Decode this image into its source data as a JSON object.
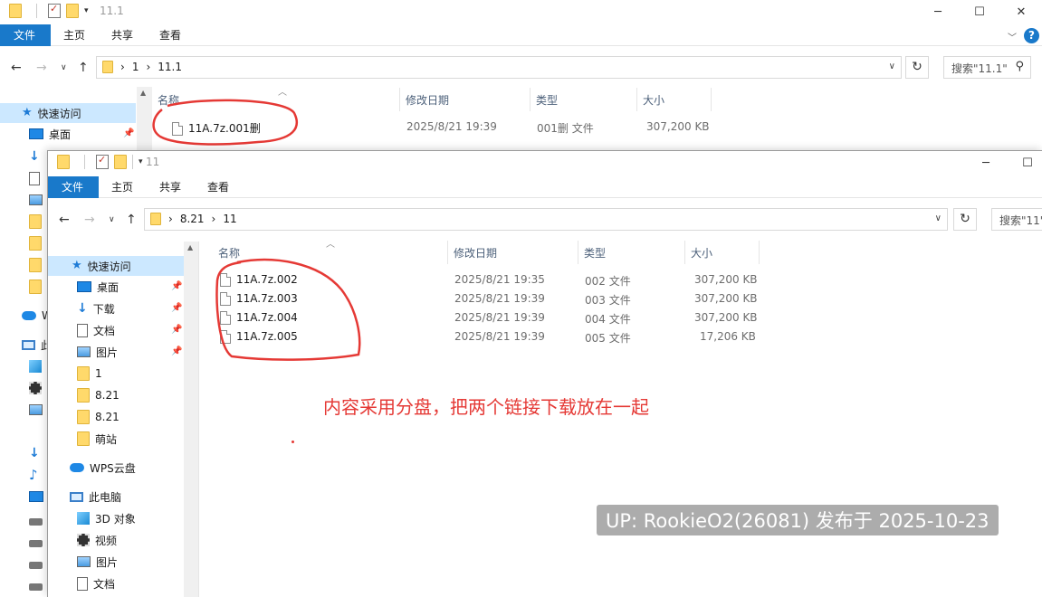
{
  "back_window": {
    "title": "11.1",
    "ribbon": {
      "file": "文件",
      "home": "主页",
      "share": "共享",
      "view": "查看"
    },
    "address": [
      "1",
      "11.1"
    ],
    "search_placeholder": "搜索\"11.1\"",
    "columns": {
      "name": "名称",
      "modified": "修改日期",
      "type": "类型",
      "size": "大小"
    },
    "files": [
      {
        "name": "11A.7z.001删",
        "modified": "2025/8/21 19:39",
        "type": "001删 文件",
        "size": "307,200 KB"
      }
    ],
    "sidebar": {
      "quick_access": "快速访问",
      "desktop": "桌面",
      "visible_partial": [
        "W",
        "此"
      ]
    }
  },
  "front_window": {
    "title": "11",
    "ribbon": {
      "file": "文件",
      "home": "主页",
      "share": "共享",
      "view": "查看"
    },
    "address": [
      "8.21",
      "11"
    ],
    "search_placeholder": "搜索\"11\"",
    "columns": {
      "name": "名称",
      "modified": "修改日期",
      "type": "类型",
      "size": "大小"
    },
    "files": [
      {
        "name": "11A.7z.002",
        "modified": "2025/8/21 19:35",
        "type": "002 文件",
        "size": "307,200 KB"
      },
      {
        "name": "11A.7z.003",
        "modified": "2025/8/21 19:39",
        "type": "003 文件",
        "size": "307,200 KB"
      },
      {
        "name": "11A.7z.004",
        "modified": "2025/8/21 19:39",
        "type": "004 文件",
        "size": "307,200 KB"
      },
      {
        "name": "11A.7z.005",
        "modified": "2025/8/21 19:39",
        "type": "005 文件",
        "size": "17,206 KB"
      }
    ],
    "sidebar": {
      "quick_access": "快速访问",
      "items": [
        {
          "label": "桌面",
          "icon": "desktop-icon",
          "pinned": true
        },
        {
          "label": "下载",
          "icon": "download-icon",
          "pinned": true
        },
        {
          "label": "文档",
          "icon": "document-icon",
          "pinned": true
        },
        {
          "label": "图片",
          "icon": "pictures-icon",
          "pinned": true
        },
        {
          "label": "1",
          "icon": "folder-icon",
          "pinned": false
        },
        {
          "label": "8.21",
          "icon": "folder-icon",
          "pinned": false
        },
        {
          "label": "8.21",
          "icon": "folder-icon",
          "pinned": false
        },
        {
          "label": "萌站",
          "icon": "folder-icon",
          "pinned": false
        }
      ],
      "wps_cloud": "WPS云盘",
      "this_pc": "此电脑",
      "pc_items": [
        {
          "label": "3D 对象",
          "icon": "3d-objects-icon"
        },
        {
          "label": "视频",
          "icon": "video-icon"
        },
        {
          "label": "图片",
          "icon": "pictures-icon"
        },
        {
          "label": "文档",
          "icon": "document-icon"
        }
      ]
    }
  },
  "annotation_text": "内容采用分盘，把两个链接下载放在一起",
  "watermark": "UP: RookieO2(26081) 发布于 2025-10-23",
  "colors": {
    "ribbon_file": "#1979ca",
    "annotation": "#e53935",
    "selected": "#cce8ff"
  }
}
